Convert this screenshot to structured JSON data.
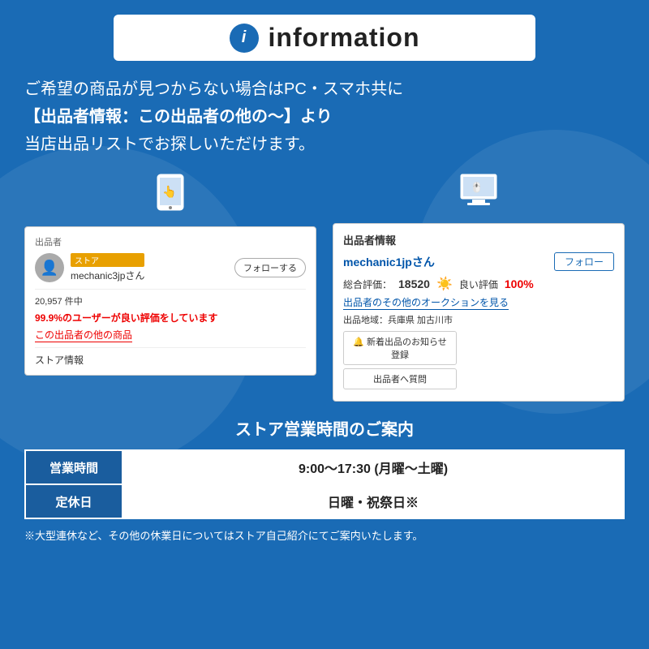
{
  "header": {
    "icon_label": "i",
    "title": "information"
  },
  "main_text": {
    "line1": "ご希望の商品が見つからない場合はPC・スマホ共に",
    "line2": "【出品者情報：この出品者の他の〜】より",
    "line3": "当店出品リストでお探しいただけます。"
  },
  "mobile_screenshot": {
    "device_icon": "📱",
    "section_label": "出品者",
    "store_badge": "ストア",
    "seller_name": "mechanic3jpさん",
    "follow_button": "フォローする",
    "stats": "20,957 件中",
    "good_rate": "99.9%のユーザーが良い評価をしています",
    "other_items_link": "この出品者の他の商品",
    "store_info_label": "ストア情報"
  },
  "pc_screenshot": {
    "device_icon": "💻",
    "section_label": "出品者情報",
    "seller_name": "mechanic1jpさん",
    "follow_button": "フォロー",
    "rating_label": "総合評価：",
    "rating_num": "18520",
    "good_label": "☀ 良い評価",
    "good_pct": "100%",
    "auction_link": "出品者のその他のオークションを見る",
    "location_label": "出品地域：兵庫県 加古川市",
    "new_listing_btn": "🔔 新着出品のお知らせ登録",
    "question_btn": "出品者へ質問"
  },
  "business": {
    "title": "ストア営業時間のご案内",
    "rows": [
      {
        "label": "営業時間",
        "value": "9:00〜17:30 (月曜〜土曜)"
      },
      {
        "label": "定休日",
        "value": "日曜・祝祭日※"
      }
    ],
    "footnote": "※大型連休など、その他の休業日についてはストア自己紹介にてご案内いたします。"
  }
}
